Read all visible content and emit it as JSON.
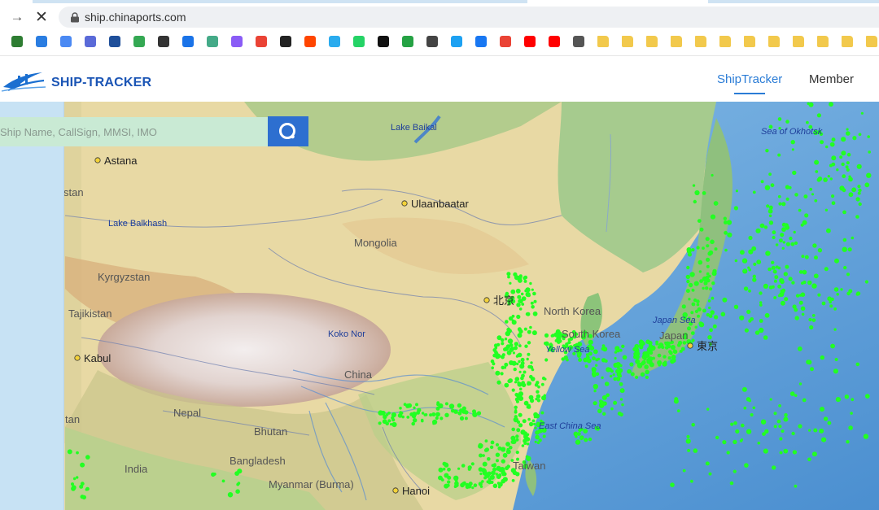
{
  "browser": {
    "url": "ship.chinaports.com",
    "bookmark_colors": [
      "#2e7d32",
      "#2a7de1",
      "#4a89f3",
      "#5a6ad8",
      "#1f4f9a",
      "#34a853",
      "#333333",
      "#1a73e8",
      "#44aa88",
      "#8a5cf6",
      "#ea4335",
      "#222222",
      "#ff4500",
      "#2aabee",
      "#25d366",
      "#111111",
      "#25a244",
      "#444444",
      "#1da1f2",
      "#1877f2",
      "#ea4335",
      "#ff0000",
      "#ff0000",
      "#555555",
      "#f2c94c",
      "#f2c94c",
      "#f2c94c",
      "#f2c94c",
      "#f2c94c",
      "#f2c94c",
      "#f2c94c",
      "#f2c94c",
      "#f2c94c",
      "#f2c94c",
      "#f2c94c",
      "#f2c94c"
    ]
  },
  "site": {
    "brand": "SHIP-TRACKER",
    "nav": {
      "shiptracker": "ShipTracker",
      "member": "Member"
    },
    "accent_color": "#2a7cd6"
  },
  "search": {
    "placeholder": "Ship Name, CallSign, MMSI, IMO"
  },
  "map": {
    "cities": {
      "astana": "Astana",
      "ulaanbaatar": "Ulaanbaatar",
      "beijing": "北京",
      "kabul": "Kabul",
      "tokyo": "東京",
      "hanoi": "Hanoi"
    },
    "labels": {
      "lake_baikal": "Lake Baikal",
      "sea_of_okhotsk": "Sea of Okhotsk",
      "lake_balkhash": "Lake Balkhash",
      "mongolia": "Mongolia",
      "kyrgyzstan": "Kyrgyzstan",
      "tajikistan": "Tajikistan",
      "north_korea": "North Korea",
      "south_korea": "South Korea",
      "japan_sea": "Japan Sea",
      "japan": "Japan",
      "koko_nor": "Koko Nor",
      "china": "China",
      "yellow_sea": "Yellow Sea",
      "nepal": "Nepal",
      "bhutan": "Bhutan",
      "india": "India",
      "bangladesh": "Bangladesh",
      "myanmar": "Myanmar (Burma)",
      "east_china_sea": "East China Sea",
      "taiwan": "Taiwan",
      "stan_partial": "stan",
      "tan_partial": "tan"
    },
    "ship_color": "#22ff22"
  }
}
